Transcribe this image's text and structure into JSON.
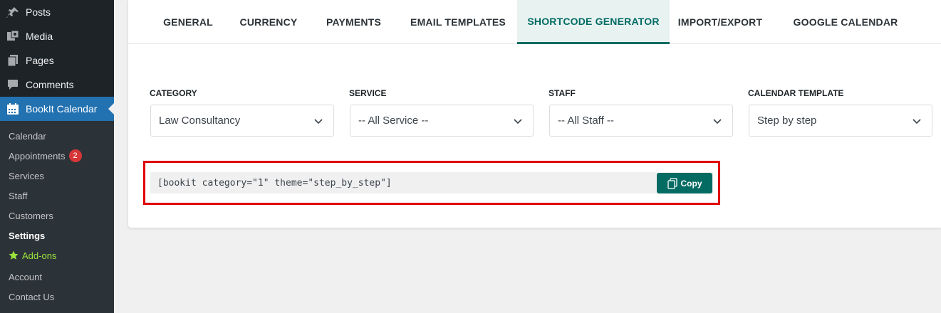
{
  "sidebar": {
    "menu": [
      {
        "label": "Posts",
        "icon": "pin-icon"
      },
      {
        "label": "Media",
        "icon": "media-icon"
      },
      {
        "label": "Pages",
        "icon": "pages-icon"
      },
      {
        "label": "Comments",
        "icon": "comment-icon"
      },
      {
        "label": "BookIt Calendar",
        "icon": "calendar-icon"
      }
    ],
    "submenu": [
      {
        "label": "Calendar"
      },
      {
        "label": "Appointments",
        "badge": "2"
      },
      {
        "label": "Services"
      },
      {
        "label": "Staff"
      },
      {
        "label": "Customers"
      },
      {
        "label": "Settings"
      },
      {
        "label": "Add-ons",
        "icon": "star-icon"
      },
      {
        "label": "Account"
      },
      {
        "label": "Contact Us"
      }
    ]
  },
  "tabs": [
    {
      "label": "GENERAL"
    },
    {
      "label": "CURRENCY"
    },
    {
      "label": "PAYMENTS"
    },
    {
      "label": "EMAIL TEMPLATES"
    },
    {
      "label": "SHORTCODE GENERATOR"
    },
    {
      "label": "IMPORT/EXPORT"
    },
    {
      "label": "GOOGLE CALENDAR"
    }
  ],
  "filters": {
    "category": {
      "label": "CATEGORY",
      "value": "Law Consultancy"
    },
    "service": {
      "label": "SERVICE",
      "value": "-- All Service --"
    },
    "staff": {
      "label": "STAFF",
      "value": "-- All Staff --"
    },
    "template": {
      "label": "CALENDAR TEMPLATE",
      "value": "Step by step"
    }
  },
  "shortcode": {
    "code": "[bookit category=\"1\" theme=\"step_by_step\"]",
    "copy_label": "Copy"
  },
  "colors": {
    "accent": "#006b63",
    "wp_blue": "#2271b1",
    "highlight": "#e00000",
    "addon_green": "#9be23d"
  }
}
